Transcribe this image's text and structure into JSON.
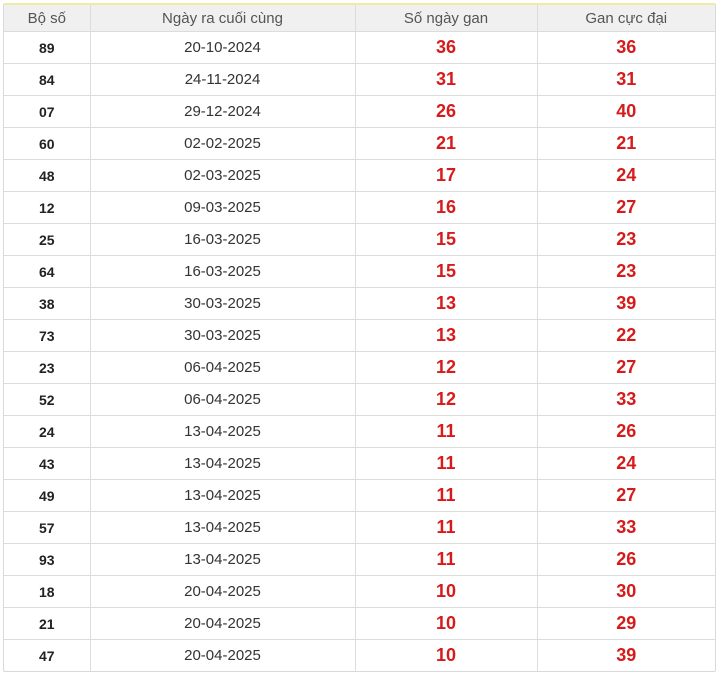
{
  "table": {
    "headers": [
      "Bộ số",
      "Ngày ra cuối cùng",
      "Số ngày gan",
      "Gan cực đại"
    ],
    "rows": [
      {
        "number": "89",
        "last_date": "20-10-2024",
        "gan_days": "36",
        "max_gan": "36"
      },
      {
        "number": "84",
        "last_date": "24-11-2024",
        "gan_days": "31",
        "max_gan": "31"
      },
      {
        "number": "07",
        "last_date": "29-12-2024",
        "gan_days": "26",
        "max_gan": "40"
      },
      {
        "number": "60",
        "last_date": "02-02-2025",
        "gan_days": "21",
        "max_gan": "21"
      },
      {
        "number": "48",
        "last_date": "02-03-2025",
        "gan_days": "17",
        "max_gan": "24"
      },
      {
        "number": "12",
        "last_date": "09-03-2025",
        "gan_days": "16",
        "max_gan": "27"
      },
      {
        "number": "25",
        "last_date": "16-03-2025",
        "gan_days": "15",
        "max_gan": "23"
      },
      {
        "number": "64",
        "last_date": "16-03-2025",
        "gan_days": "15",
        "max_gan": "23"
      },
      {
        "number": "38",
        "last_date": "30-03-2025",
        "gan_days": "13",
        "max_gan": "39"
      },
      {
        "number": "73",
        "last_date": "30-03-2025",
        "gan_days": "13",
        "max_gan": "22"
      },
      {
        "number": "23",
        "last_date": "06-04-2025",
        "gan_days": "12",
        "max_gan": "27"
      },
      {
        "number": "52",
        "last_date": "06-04-2025",
        "gan_days": "12",
        "max_gan": "33"
      },
      {
        "number": "24",
        "last_date": "13-04-2025",
        "gan_days": "11",
        "max_gan": "26"
      },
      {
        "number": "43",
        "last_date": "13-04-2025",
        "gan_days": "11",
        "max_gan": "24"
      },
      {
        "number": "49",
        "last_date": "13-04-2025",
        "gan_days": "11",
        "max_gan": "27"
      },
      {
        "number": "57",
        "last_date": "13-04-2025",
        "gan_days": "11",
        "max_gan": "33"
      },
      {
        "number": "93",
        "last_date": "13-04-2025",
        "gan_days": "11",
        "max_gan": "26"
      },
      {
        "number": "18",
        "last_date": "20-04-2025",
        "gan_days": "10",
        "max_gan": "30"
      },
      {
        "number": "21",
        "last_date": "20-04-2025",
        "gan_days": "10",
        "max_gan": "29"
      },
      {
        "number": "47",
        "last_date": "20-04-2025",
        "gan_days": "10",
        "max_gan": "39"
      }
    ]
  },
  "colors": {
    "header_background": "#f0f0f0",
    "header_top_accent": "#f3e9a6",
    "highlight_value": "#d71b1b",
    "grid_line": "#dcdcdc"
  }
}
